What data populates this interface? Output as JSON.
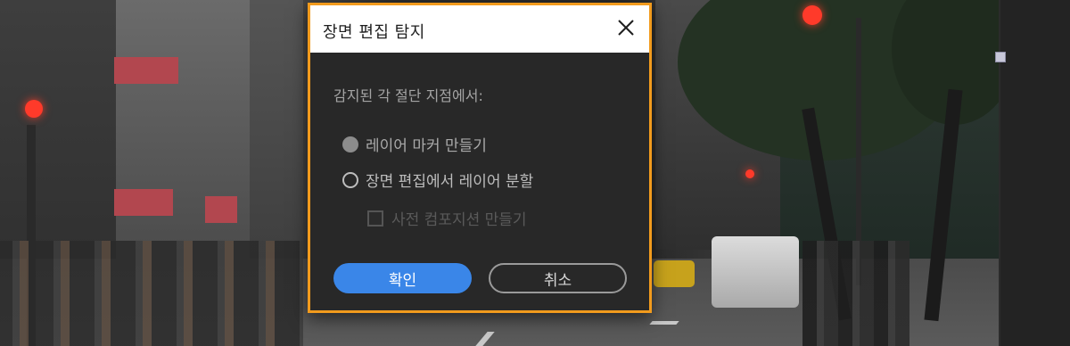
{
  "dialog": {
    "title": "장면 편집 탐지",
    "instruction": "감지된 각 절단 지점에서:",
    "options": [
      {
        "label": "레이어 마커 만들기",
        "selected": false,
        "enabled": false
      },
      {
        "label": "장면 편집에서 레이어 분할",
        "selected": false,
        "enabled": true
      }
    ],
    "checkbox": {
      "label": "사전 컴포지션 만들기",
      "checked": false,
      "enabled": false
    },
    "buttons": {
      "ok": "확인",
      "cancel": "취소"
    }
  },
  "icons": {
    "close": "close-icon",
    "scroll": "scroll-handle"
  },
  "colors": {
    "accent_border": "#f29b1d",
    "primary_button": "#3a86e8",
    "dialog_background": "#282828"
  }
}
